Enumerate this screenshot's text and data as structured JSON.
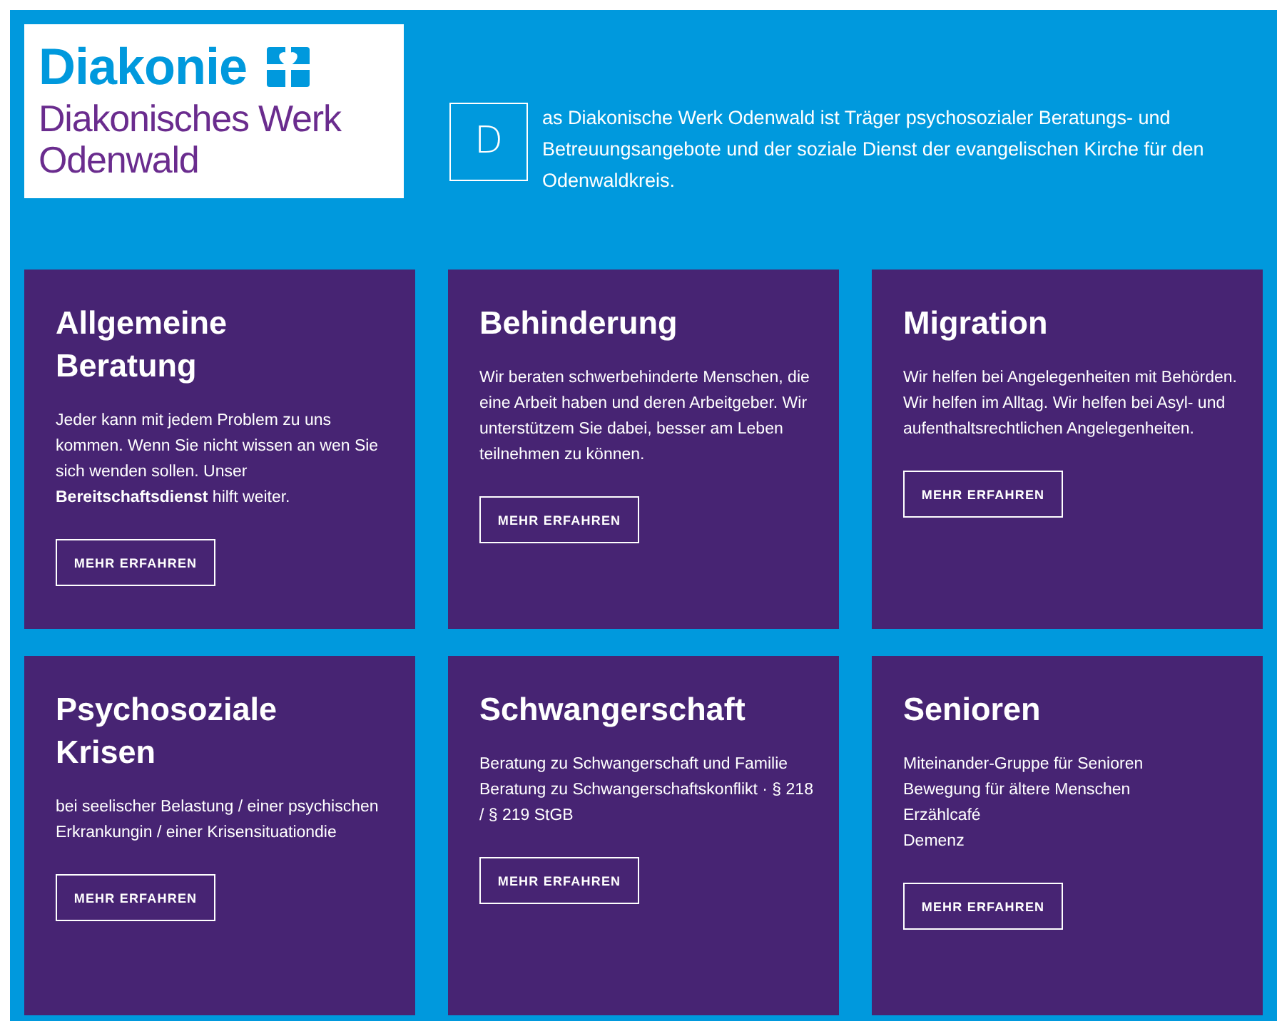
{
  "logo": {
    "brand": "Diakonie",
    "subtitle": "Diakonisches Werk Odenwald"
  },
  "intro": {
    "initial": "D",
    "text": "as Diakonische Werk Odenwald ist Träger psychosozialer Beratungs- und Betreuungsangebote und der soziale Dienst der evangelischen Kirche für den Odenwaldkreis."
  },
  "cards": [
    {
      "title": "Allgemeine Beratung",
      "body": "Jeder kann mit jedem Problem zu uns kommen. Wenn Sie nicht wissen an wen Sie sich wenden sollen. Unser **Bereitschaftsdienst** hilft weiter.",
      "button": "MEHR ERFAHREN"
    },
    {
      "title": "Behinderung",
      "body": "Wir beraten schwerbehinderte Menschen, die eine Arbeit haben und deren Arbeitgeber. Wir unterstützem Sie dabei, besser am Leben teilnehmen zu können.",
      "button": "MEHR ERFAHREN"
    },
    {
      "title": "Migration",
      "body": "Wir helfen bei Angelegenheiten mit Behörden. Wir helfen im Alltag. Wir helfen bei Asyl- und aufenthaltsrechtlichen Angelegenheiten.",
      "button": "MEHR ERFAHREN"
    },
    {
      "title": "Psychosoziale Krisen",
      "body": "bei seelischer Belastung / einer psychischen Erkrankungin / einer Krisensituationdie",
      "button": "MEHR ERFAHREN"
    },
    {
      "title": "Schwangerschaft",
      "body": "Beratung zu Schwangerschaft und Familie\nBeratung zu Schwangerschaftskonflikt · § 218 / § 219 StGB",
      "button": "MEHR ERFAHREN"
    },
    {
      "title": "Senioren",
      "body": "Miteinander-Gruppe für Senioren\nBewegung für ältere Menschen\nErzählcafé\nDemenz",
      "button": "MEHR ERFAHREN"
    }
  ]
}
